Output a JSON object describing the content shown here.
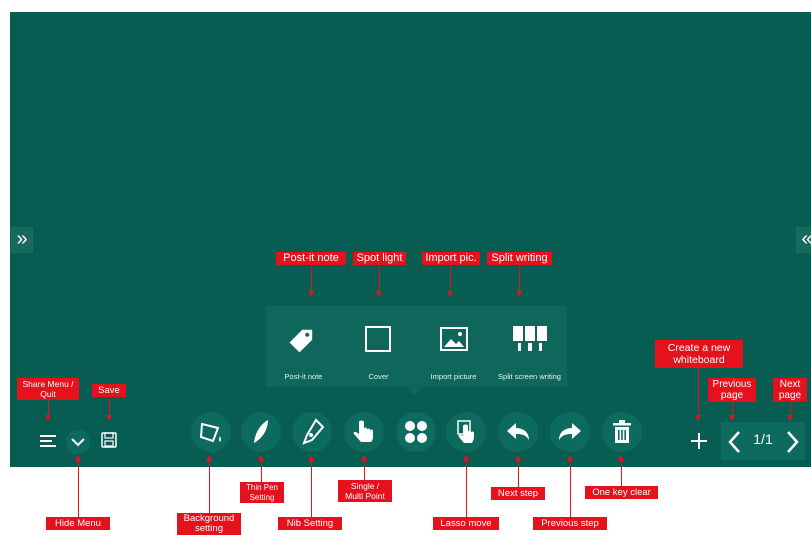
{
  "popup": {
    "items": [
      {
        "caption": "Post-it note",
        "icon": "tag-icon"
      },
      {
        "caption": "Cover",
        "icon": "square-cover-icon"
      },
      {
        "caption": "Import picture",
        "icon": "image-icon"
      },
      {
        "caption": "Split screen writing",
        "icon": "split-screen-icon"
      }
    ]
  },
  "pager": {
    "page": "1/1"
  },
  "labels": {
    "post_it": "Post-it note",
    "spot_light": "Spot light",
    "import_pic": "Import pic.",
    "split_writing": "Split writing",
    "share_menu": "Share Menu / Quit",
    "save": "Save",
    "hide_menu": "Hide Menu",
    "background": "Background setting",
    "thin_pen": "Thin Pen Setting",
    "nib": "Nib Setting",
    "single_multi": "Single / Multi Point",
    "lasso": "Lasso move",
    "next_step": "Next step",
    "previous_step": "Previous step",
    "one_key_clear": "One key clear",
    "create_whiteboard": "Create a new whiteboard",
    "previous_page": "Previous page",
    "next_page": "Next page"
  },
  "colors": {
    "board": "#075d52",
    "label": "#e5121e",
    "icon": "#ffffff"
  }
}
